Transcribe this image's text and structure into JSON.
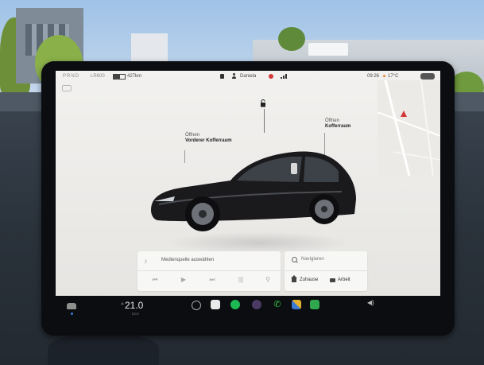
{
  "status_bar": {
    "gear": "PRND",
    "range_label": "LR600",
    "range_km": "427km",
    "profile_name": "Daniela",
    "time": "09:26",
    "temperature": "17°C"
  },
  "car_view": {
    "frunk_action": "Öffnen",
    "frunk_name": "Vorderer Kofferraum",
    "trunk_action": "Öffnen",
    "trunk_name": "Kofferraum",
    "car_color": "#1a1a1c"
  },
  "media": {
    "source_placeholder": "Medienquelle auswählen"
  },
  "navigation": {
    "search_placeholder": "Navigieren",
    "home_label": "Zuhause",
    "work_label": "Arbeit"
  },
  "taskbar": {
    "temperature": "21.0",
    "temperature_sub": "ECO",
    "icons": [
      "car-icon",
      "fan-icon",
      "phone-app-icon",
      "spotify-icon",
      "camera-icon",
      "call-icon",
      "apps-icon",
      "calendar-icon",
      "volume-icon"
    ]
  },
  "colors": {
    "screen_bg": "#eeedeb",
    "accent_red": "#d23a3a",
    "spotify_green": "#1db954",
    "call_green": "#39c247"
  }
}
